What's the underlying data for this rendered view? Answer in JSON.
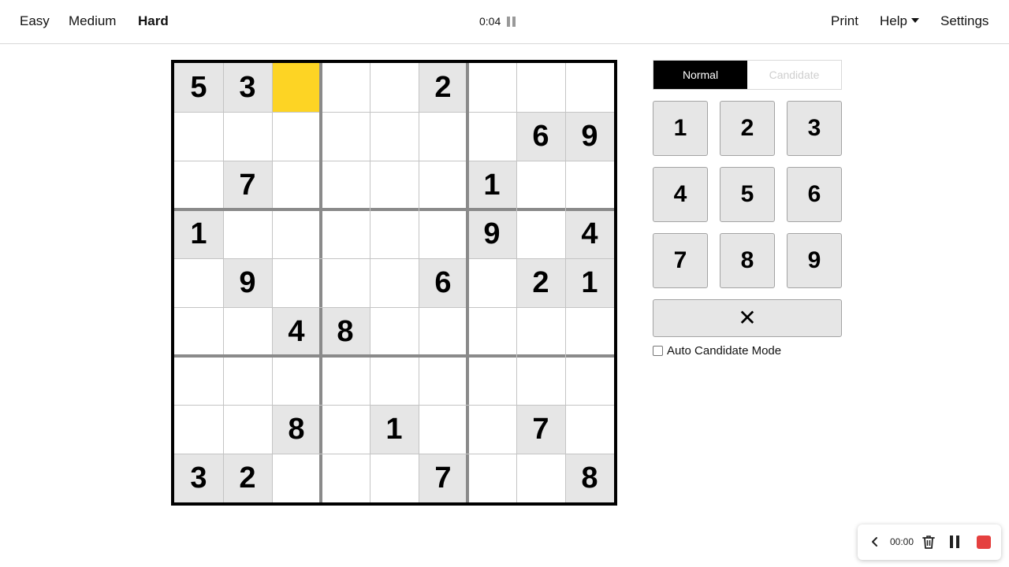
{
  "header": {
    "difficulties": [
      {
        "label": "Easy",
        "active": false
      },
      {
        "label": "Medium",
        "active": false
      },
      {
        "label": "Hard",
        "active": true
      }
    ],
    "timer": "0:04",
    "print_label": "Print",
    "help_label": "Help",
    "settings_label": "Settings"
  },
  "board": {
    "selected": [
      0,
      2
    ],
    "rows": [
      [
        "5",
        "3",
        "",
        "",
        "",
        "2",
        "",
        "",
        ""
      ],
      [
        "",
        "",
        "",
        "",
        "",
        "",
        "",
        "6",
        "9"
      ],
      [
        "",
        "7",
        "",
        "",
        "",
        "",
        "1",
        "",
        ""
      ],
      [
        "1",
        "",
        "",
        "",
        "",
        "",
        "9",
        "",
        "4"
      ],
      [
        "",
        "9",
        "",
        "",
        "",
        "6",
        "",
        "2",
        "1"
      ],
      [
        "",
        "",
        "4",
        "8",
        "",
        "",
        "",
        "",
        ""
      ],
      [
        "",
        "",
        "",
        "",
        "",
        "",
        "",
        "",
        ""
      ],
      [
        "",
        "",
        "8",
        "",
        "1",
        "",
        "",
        "7",
        ""
      ],
      [
        "3",
        "2",
        "",
        "",
        "",
        "7",
        "",
        "",
        "8"
      ]
    ]
  },
  "panel": {
    "mode_normal": "Normal",
    "mode_candidate": "Candidate",
    "keys": [
      "1",
      "2",
      "3",
      "4",
      "5",
      "6",
      "7",
      "8",
      "9"
    ],
    "erase_label": "✕",
    "auto_candidate_label": "Auto Candidate Mode"
  },
  "recorder": {
    "time": "00:00"
  },
  "colors": {
    "selected": "#fdd424",
    "given_bg": "#e6e6e6",
    "recorder_stop": "#e5403f"
  }
}
